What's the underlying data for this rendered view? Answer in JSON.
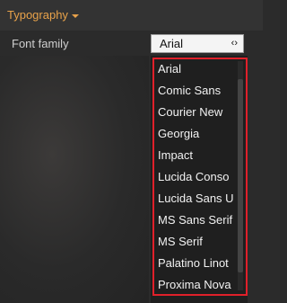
{
  "section": {
    "title": "Typography"
  },
  "row": {
    "label": "Font family"
  },
  "select": {
    "value": "Arial"
  },
  "dropdown": {
    "options": [
      "Arial",
      "Comic Sans",
      "Courier New",
      "Georgia",
      "Impact",
      "Lucida Conso",
      "Lucida Sans U",
      "MS Sans Serif",
      "MS Serif",
      "Palatino Linot",
      "Proxima Nova"
    ]
  },
  "colors": {
    "accent": "#e8a24a",
    "highlight_border": "#e0202a",
    "dropdown_bg": "#1f1f1f",
    "panel_bg": "#2b2b2b"
  },
  "icons": {
    "section_caret": "caret-down-icon",
    "select_arrow": "select-arrow-icon"
  }
}
